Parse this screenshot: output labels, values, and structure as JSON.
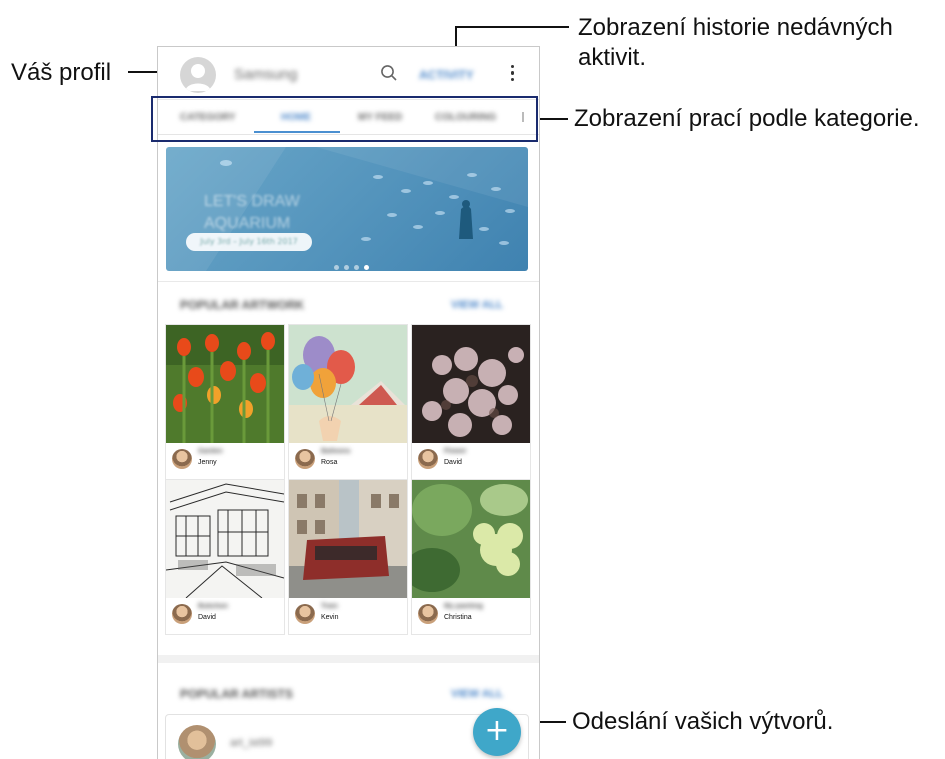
{
  "callouts": {
    "profile": "Váš profil",
    "activity_line1": "Zobrazení historie nedávných",
    "activity_line2": "aktivit.",
    "category": "Zobrazení prací podle kategorie.",
    "upload": "Odeslání vašich výtvorů."
  },
  "header": {
    "account_name": "Samsung",
    "activity_label": "ACTIVITY"
  },
  "tabs": [
    "CATEGORY",
    "HOME",
    "MY FEED",
    "COLOURING"
  ],
  "banner": {
    "title_line1": "LET'S DRAW",
    "title_line2": "AQUARIUM",
    "date_range": "July 3rd – July 16th 2017"
  },
  "sections": {
    "popular_artwork": "POPULAR ARTWORK",
    "popular_artists": "POPULAR ARTISTS",
    "view_all": "VIEW ALL"
  },
  "artworks": [
    {
      "title": "Garden",
      "user": "Jenny"
    },
    {
      "title": "Balloons",
      "user": "Rosa"
    },
    {
      "title": "Flower",
      "user": "David"
    },
    {
      "title": "Bukchon",
      "user": "David"
    },
    {
      "title": "Train",
      "user": "Kevin"
    },
    {
      "title": "My painting",
      "user": "Christina"
    }
  ],
  "artist": {
    "name": "art_ist99"
  },
  "fab_icon": "plus-icon",
  "colors": {
    "accent": "#4c87c9",
    "fab": "#3fa7c9",
    "highlight": "#1a2b6e"
  }
}
